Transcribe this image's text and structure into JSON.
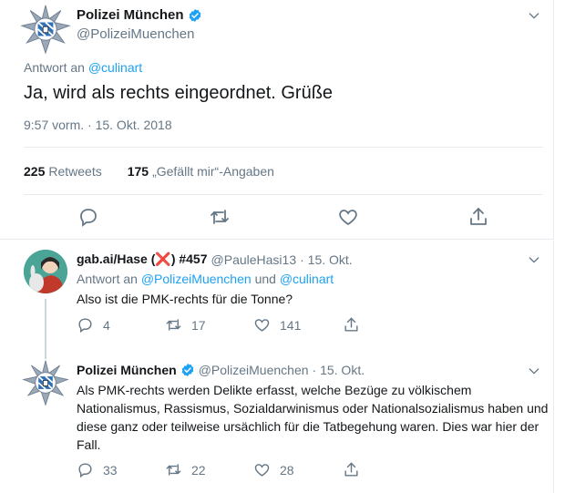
{
  "main_tweet": {
    "author_name": "Polizei München",
    "author_handle": "@PolizeiMuenchen",
    "reply_prefix": "Antwort an",
    "reply_to": "@culinart",
    "text": "Ja, wird als rechts eingeordnet. Grüße",
    "timestamp": "9:57 vorm. · 15. Okt. 2018",
    "retweets_count": "225",
    "retweets_label": "Retweets",
    "likes_count": "175",
    "likes_label": "„Gefällt mir“-Angaben"
  },
  "replies": [
    {
      "author_name_prefix": "gab.ai/Hase (",
      "author_name_mark": "❌",
      "author_name_suffix": ") #457",
      "author_handle": "@PauleHasi13",
      "date": "· 15. Okt.",
      "reply_prefix": "Antwort an",
      "reply_to_1": "@PolizeiMuenchen",
      "reply_and": "und",
      "reply_to_2": "@culinart",
      "text": "Also ist die PMK-rechts für die Tonne?",
      "reply_count": "4",
      "retweet_count": "17",
      "like_count": "141"
    },
    {
      "author_name": "Polizei München",
      "author_handle": "@PolizeiMuenchen",
      "date": "· 15. Okt.",
      "text": "Als PMK-rechts werden Delikte erfasst, welche Bezüge zu völkischem Nationalismus, Rassismus, Sozialdarwinismus oder Nationalsozialismus haben und diese ganz oder teilweise ursächlich für die Tatbegehung waren. Dies war hier der Fall.",
      "reply_count": "33",
      "retweet_count": "22",
      "like_count": "28"
    }
  ],
  "colors": {
    "accent": "#1da1f2",
    "muted": "#657786",
    "text": "#14171a",
    "border": "#e6ecf0",
    "mark": "#e0245e"
  },
  "icons": [
    "police-badge-icon",
    "verified-badge-icon",
    "chevron-down-icon",
    "reply-icon",
    "retweet-icon",
    "like-icon",
    "share-icon"
  ]
}
